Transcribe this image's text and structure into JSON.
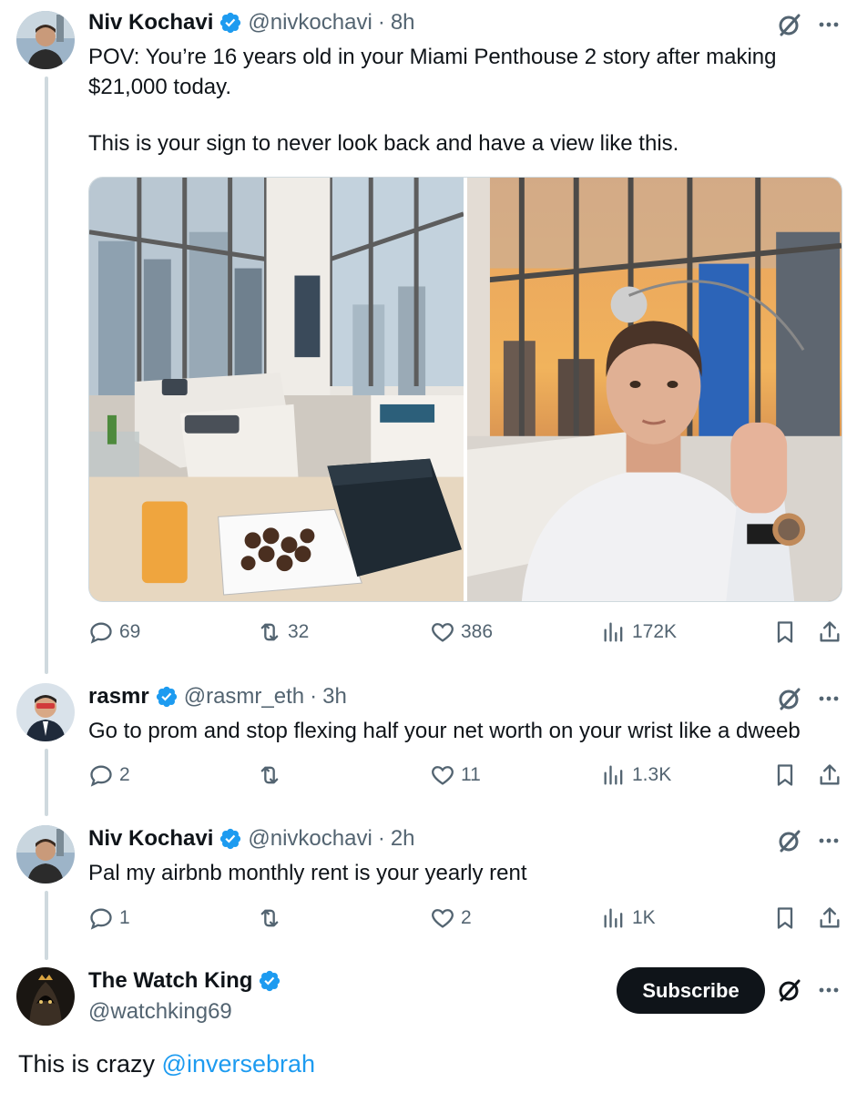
{
  "tweets": [
    {
      "name": "Niv Kochavi",
      "handle": "@nivkochavi",
      "time": "8h",
      "text_lines": [
        "POV: You’re 16 years old in your Miami Penthouse 2 story after making",
        "$21,000 today."
      ],
      "text_lines2": [
        "This is your sign to never look back and have a view like this."
      ],
      "replies": "69",
      "reposts": "32",
      "likes": "386",
      "views": "172K"
    },
    {
      "name": "rasmr",
      "handle": "@rasmr_eth",
      "time": "3h",
      "text": "Go to prom and stop flexing half your net worth on your wrist like a dweeb",
      "replies": "2",
      "reposts": "",
      "likes": "11",
      "views": "1.3K"
    },
    {
      "name": "Niv Kochavi",
      "handle": "@nivkochavi",
      "time": "2h",
      "text": "Pal my airbnb monthly rent is your yearly rent",
      "replies": "1",
      "reposts": "",
      "likes": "2",
      "views": "1K"
    }
  ],
  "reply_author": {
    "name": "The Watch King",
    "handle": "@watchking69",
    "subscribe_label": "Subscribe"
  },
  "reply": {
    "text": "This is crazy ",
    "mention": "@inversebrah"
  },
  "colors": {
    "verified_blue": "#1d9bf0",
    "secondary_text": "#536471",
    "thread_line": "#cfd9de",
    "subscribe_bg": "#0f1419"
  },
  "icons": [
    "verified-badge-icon",
    "grok-icon",
    "more-icon",
    "reply-icon",
    "repost-icon",
    "like-icon",
    "views-icon",
    "bookmark-icon",
    "share-icon"
  ]
}
